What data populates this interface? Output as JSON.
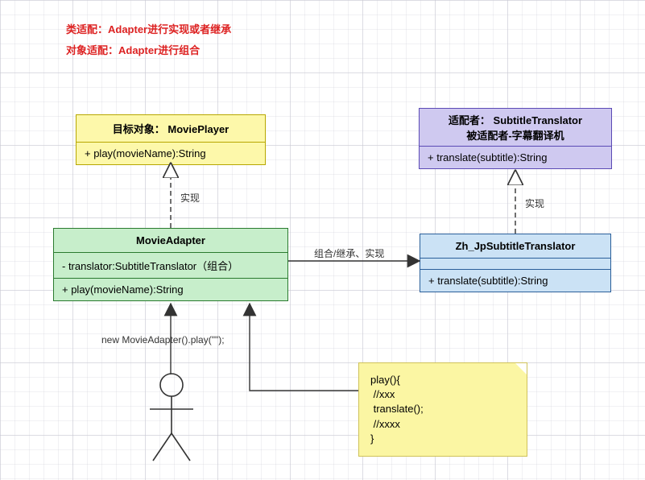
{
  "notes": {
    "class_adapter": "类适配：Adapter进行实现或者继承",
    "object_adapter": "对象适配：Adapter进行组合"
  },
  "labels": {
    "realize_left": "实现",
    "realize_right": "实现",
    "assoc": "组合/继承、实现",
    "call": "new MovieAdapter().play(\"\");"
  },
  "boxes": {
    "target": {
      "title": "目标对象： MoviePlayer",
      "method": "+ play(movieName):String"
    },
    "adapter": {
      "title": "MovieAdapter",
      "attr": "- translator:SubtitleTranslator（组合）",
      "method": "+ play(movieName):String"
    },
    "adaptee": {
      "title1": "适配者： SubtitleTranslator",
      "title2": "被适配者-字幕翻译机",
      "method": "+ translate(subtitle):String"
    },
    "impl": {
      "title": "Zh_JpSubtitleTranslator",
      "method": "+ translate(subtitle):String"
    }
  },
  "sticky": {
    "code": "play(){\n //xxx\n translate();\n //xxxx\n}"
  }
}
